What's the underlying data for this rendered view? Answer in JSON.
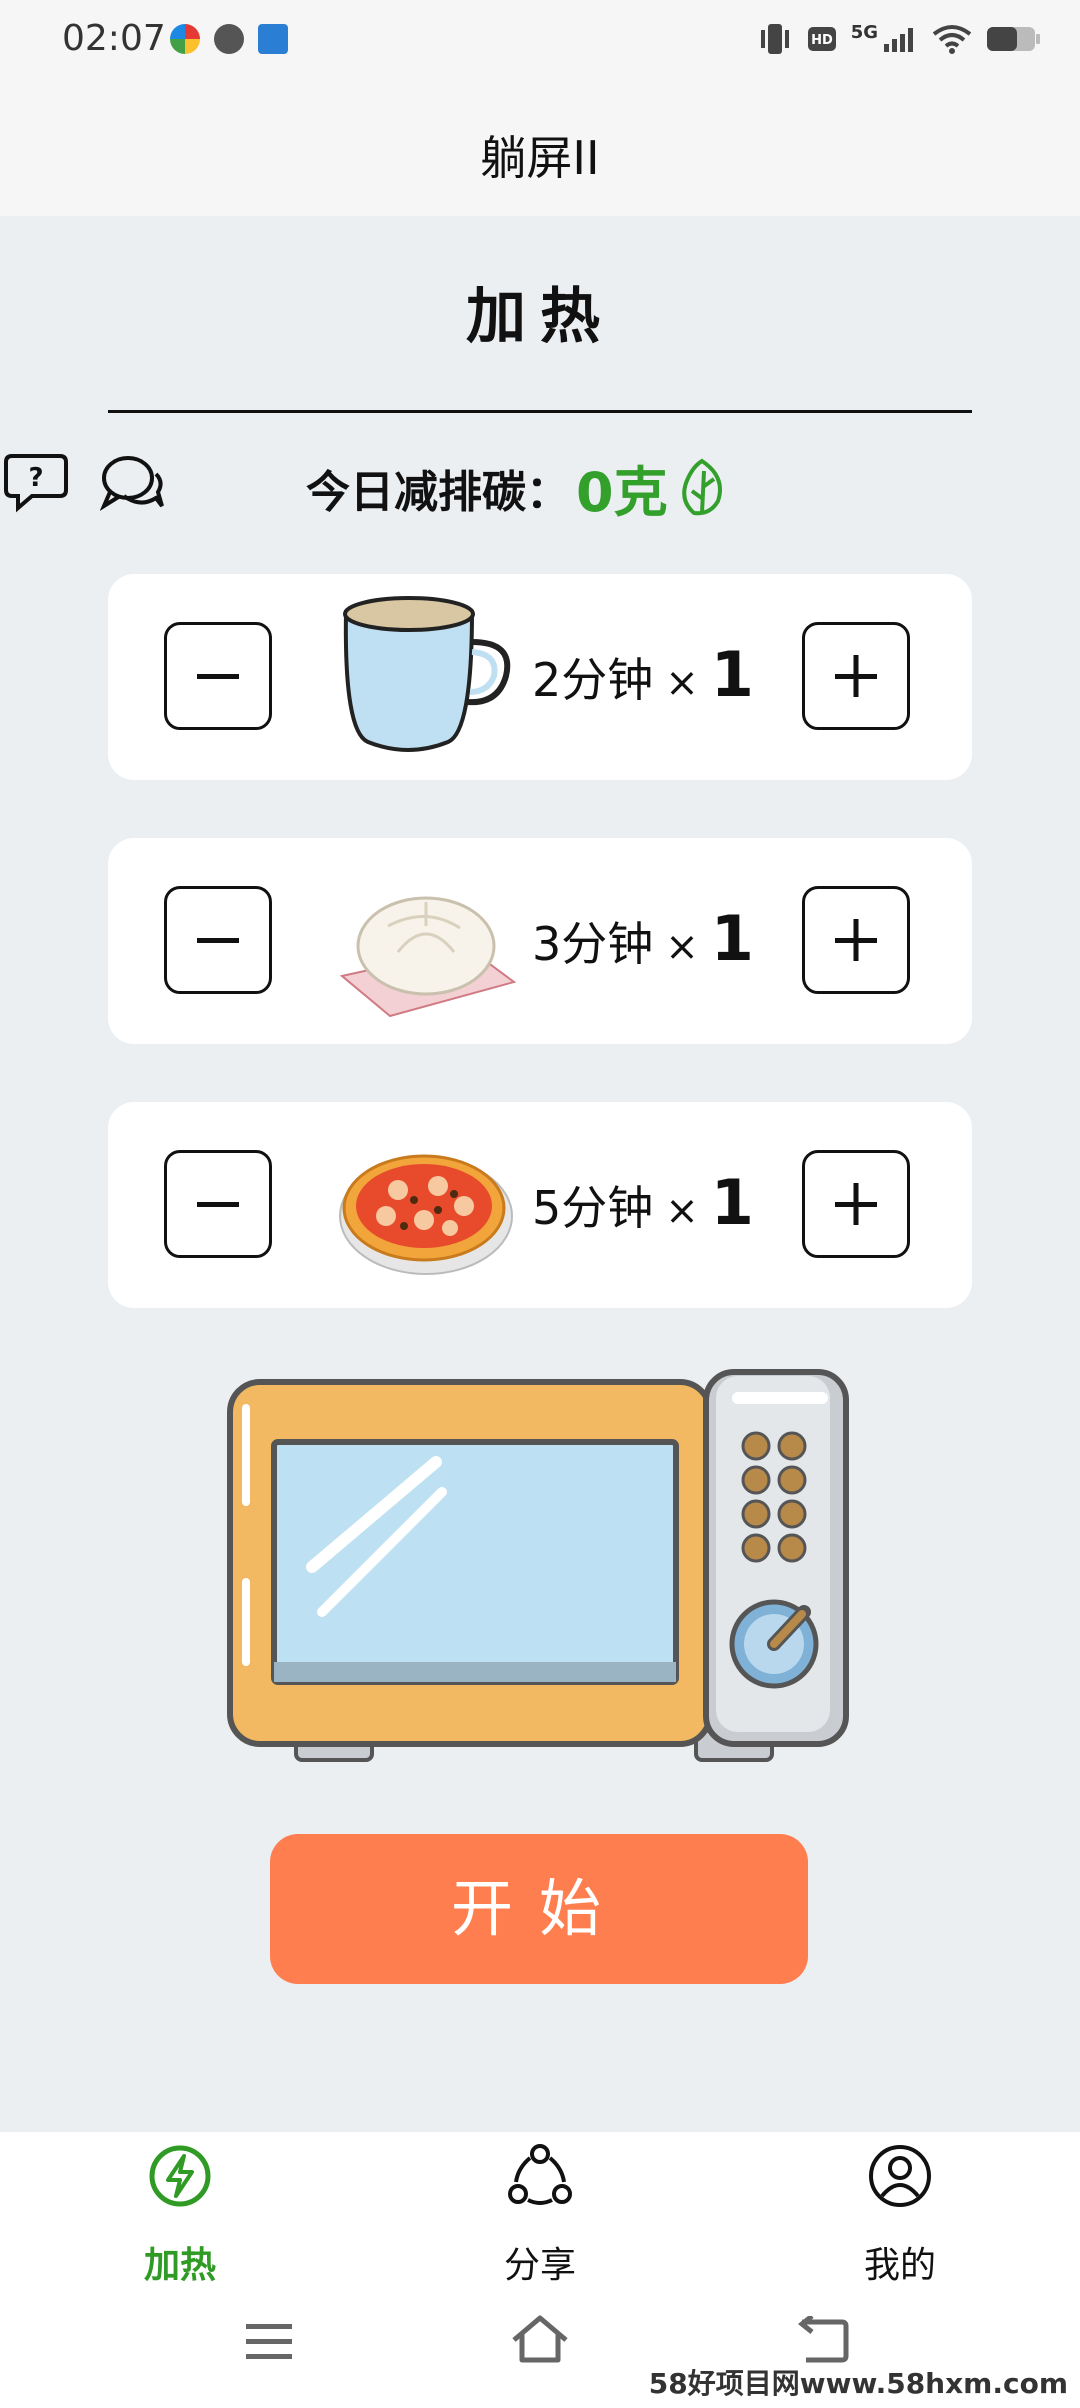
{
  "status_bar": {
    "time": "02:07",
    "network": "5G"
  },
  "app_title": "躺屏II",
  "heading": "加热",
  "carbon": {
    "label": "今日减排碳：",
    "value": "0克"
  },
  "items": [
    {
      "food": "cup-icon",
      "time": "2分钟",
      "times": "×",
      "count": "1"
    },
    {
      "food": "bun-icon",
      "time": "3分钟",
      "times": "×",
      "count": "1"
    },
    {
      "food": "pizza-icon",
      "time": "5分钟",
      "times": "×",
      "count": "1"
    }
  ],
  "start_label": "开始",
  "nav": [
    {
      "label": "加热",
      "active": true
    },
    {
      "label": "分享"
    },
    {
      "label": "我的"
    }
  ],
  "watermark": "58好项目网www.58hxm.com",
  "colors": {
    "accent": "#33a02c",
    "start": "#ff7e4f",
    "background": "#eceff2"
  }
}
